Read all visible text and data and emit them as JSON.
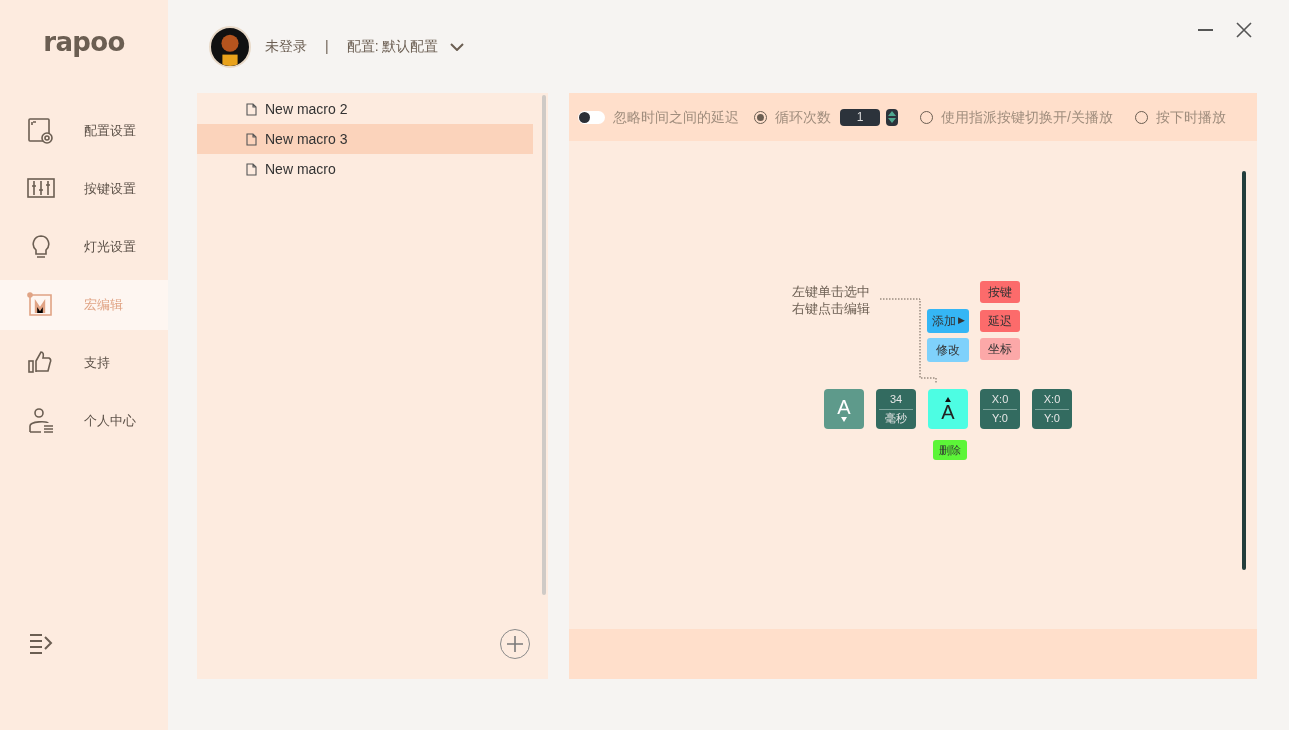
{
  "logo": "rapoo",
  "header": {
    "user": "未登录",
    "separator": "|",
    "profile": "配置: 默认配置"
  },
  "nav": [
    {
      "kind": "profile",
      "label": "配置设置",
      "selected": false
    },
    {
      "kind": "keys",
      "label": "按键设置",
      "selected": false
    },
    {
      "kind": "light",
      "label": "灯光设置",
      "selected": false
    },
    {
      "kind": "macro",
      "label": "宏编辑",
      "selected": true
    },
    {
      "kind": "support",
      "label": "支持",
      "selected": false
    },
    {
      "kind": "user",
      "label": "个人中心",
      "selected": false
    }
  ],
  "macros": [
    {
      "name": "New macro 2",
      "selected": false
    },
    {
      "name": "New macro 3",
      "selected": true
    },
    {
      "name": "New macro",
      "selected": false
    }
  ],
  "options": {
    "ignore_delay": {
      "label": "忽略时间之间的延迟",
      "on": false
    },
    "loop_count": "1",
    "modes": [
      {
        "label": "循环次数",
        "selected": true
      },
      {
        "label": "使用指派按键切换开/关播放",
        "selected": false
      },
      {
        "label": "按下时播放",
        "selected": false
      }
    ]
  },
  "hint": [
    "左键单击选中",
    "右键点击编辑"
  ],
  "context_menu": {
    "actions": [
      {
        "kind": "submenu",
        "label": "添加",
        "arrow": "▶"
      },
      {
        "kind": "plain",
        "label": "修改"
      }
    ],
    "submenu": [
      {
        "label": "按键",
        "disabled": false
      },
      {
        "label": "延迟",
        "disabled": false
      },
      {
        "label": "坐标",
        "disabled": true
      }
    ]
  },
  "events": [
    {
      "kind": "key",
      "label": "A",
      "released": false,
      "selected": false
    },
    {
      "kind": "delay",
      "value": "34",
      "unit": "毫秒"
    },
    {
      "kind": "key",
      "label": "A",
      "released": true,
      "selected": true
    },
    {
      "kind": "coord",
      "x": "X:0",
      "y": "Y:0"
    },
    {
      "kind": "coord",
      "x": "X:0",
      "y": "Y:0"
    }
  ],
  "delete_label": "删除"
}
